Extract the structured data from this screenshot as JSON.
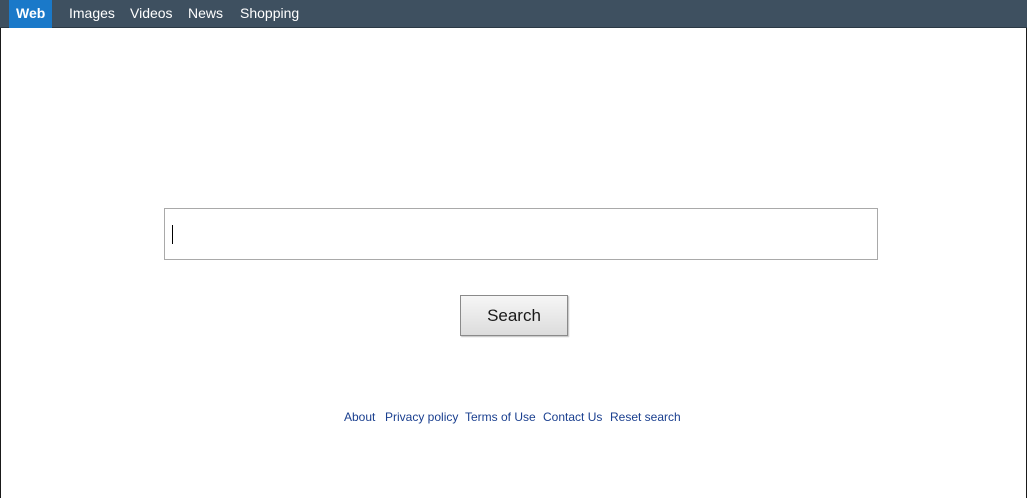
{
  "nav": {
    "items": [
      {
        "label": "Web",
        "active": true
      },
      {
        "label": "Images",
        "active": false
      },
      {
        "label": "Videos",
        "active": false
      },
      {
        "label": "News",
        "active": false
      },
      {
        "label": "Shopping",
        "active": false
      }
    ]
  },
  "search": {
    "value": "",
    "placeholder": "",
    "button_label": "Search"
  },
  "footer": {
    "links": [
      {
        "label": "About"
      },
      {
        "label": "Privacy policy"
      },
      {
        "label": "Terms of Use"
      },
      {
        "label": "Contact Us"
      },
      {
        "label": "Reset search"
      }
    ]
  },
  "colors": {
    "nav_background": "#3e5060",
    "nav_active": "#1a79c9",
    "link": "#1a3f8f"
  }
}
